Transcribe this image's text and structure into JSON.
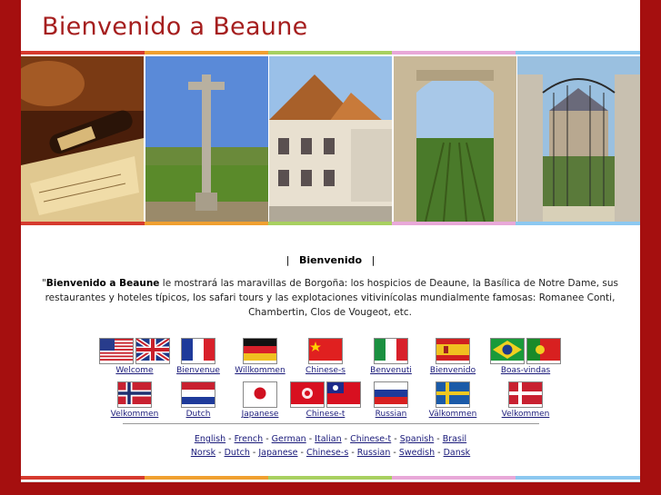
{
  "header": {
    "title": "Bienvenido a Beaune"
  },
  "colors": {
    "accent_red": "#a51e1e",
    "stripes": [
      "#d63a2e",
      "#f0a030",
      "#a8d060",
      "#e8a8d8",
      "#8cc8f0"
    ]
  },
  "photos": [
    {
      "name": "wine-bottle-photo"
    },
    {
      "name": "stone-cross-photo"
    },
    {
      "name": "hospices-photo"
    },
    {
      "name": "montrachet-gate-photo"
    },
    {
      "name": "chateau-gate-photo"
    }
  ],
  "nav": {
    "sep_left": "|",
    "current": "Bienvenido",
    "sep_right": "|"
  },
  "intro": {
    "quote": "\"",
    "bold": "Bienvenido a Beaune",
    "text": " le mostrará las maravillas de Borgoña: los hospicios de Deaune, la Basílica de Notre Dame, sus restaurantes y hoteles típicos, los safari tours y las explotaciones vitivinícolas mundialmente famosas: Romanee Conti, Chambertin, Clos de Vougeot, etc."
  },
  "flags_row1": [
    {
      "label": "Welcome",
      "flags": [
        "us-flag",
        "uk-flag"
      ]
    },
    {
      "label": "Bienvenue",
      "flags": [
        "france-flag"
      ]
    },
    {
      "label": "Willkommen",
      "flags": [
        "germany-flag"
      ]
    },
    {
      "label": "Chinese-s",
      "flags": [
        "china-flag"
      ]
    },
    {
      "label": "Benvenuti",
      "flags": [
        "italy-flag"
      ]
    },
    {
      "label": "Bienvenido",
      "flags": [
        "spain-flag"
      ]
    },
    {
      "label": "Boas-vindas",
      "flags": [
        "brazil-flag",
        "portugal-flag"
      ]
    }
  ],
  "flags_row2": [
    {
      "label": "Velkommen",
      "flags": [
        "norway-flag"
      ]
    },
    {
      "label": "Dutch",
      "flags": [
        "netherlands-flag"
      ]
    },
    {
      "label": "Japanese",
      "flags": [
        "japan-flag"
      ]
    },
    {
      "label": "Chinese-t",
      "flags": [
        "hongkong-flag",
        "taiwan-flag"
      ]
    },
    {
      "label": "Russian",
      "flags": [
        "russia-flag"
      ]
    },
    {
      "label": "Välkommen",
      "flags": [
        "sweden-flag"
      ]
    },
    {
      "label": "Velkommen",
      "flags": [
        "denmark-flag"
      ]
    }
  ],
  "links_line1": [
    "English",
    "French",
    "German",
    "Italian",
    "Chinese-t",
    "Spanish",
    "Brasil"
  ],
  "links_line2": [
    "Norsk",
    "Dutch",
    "Japanese",
    "Chinese-s",
    "Russian",
    "Swedish",
    "Dansk"
  ],
  "link_separator": " - "
}
